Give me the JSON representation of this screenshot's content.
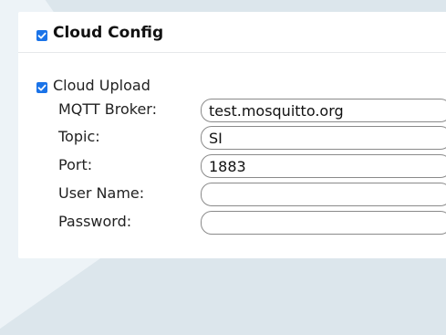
{
  "cloud_config": {
    "title": "Cloud Config",
    "enabled": true,
    "cloud_upload": {
      "label": "Cloud Upload",
      "checked": true
    },
    "fields": {
      "mqtt_broker": {
        "label": "MQTT Broker:",
        "value": "test.mosquitto.org"
      },
      "topic": {
        "label": "Topic:",
        "value": "SI"
      },
      "port": {
        "label": "Port:",
        "value": "1883"
      },
      "user_name": {
        "label": "User Name:",
        "value": ""
      },
      "password": {
        "label": "Password:",
        "value": ""
      }
    }
  },
  "colors": {
    "checkbox_accent": "#1a73e8",
    "background": "#dce6ec",
    "panel": "#ffffff"
  }
}
